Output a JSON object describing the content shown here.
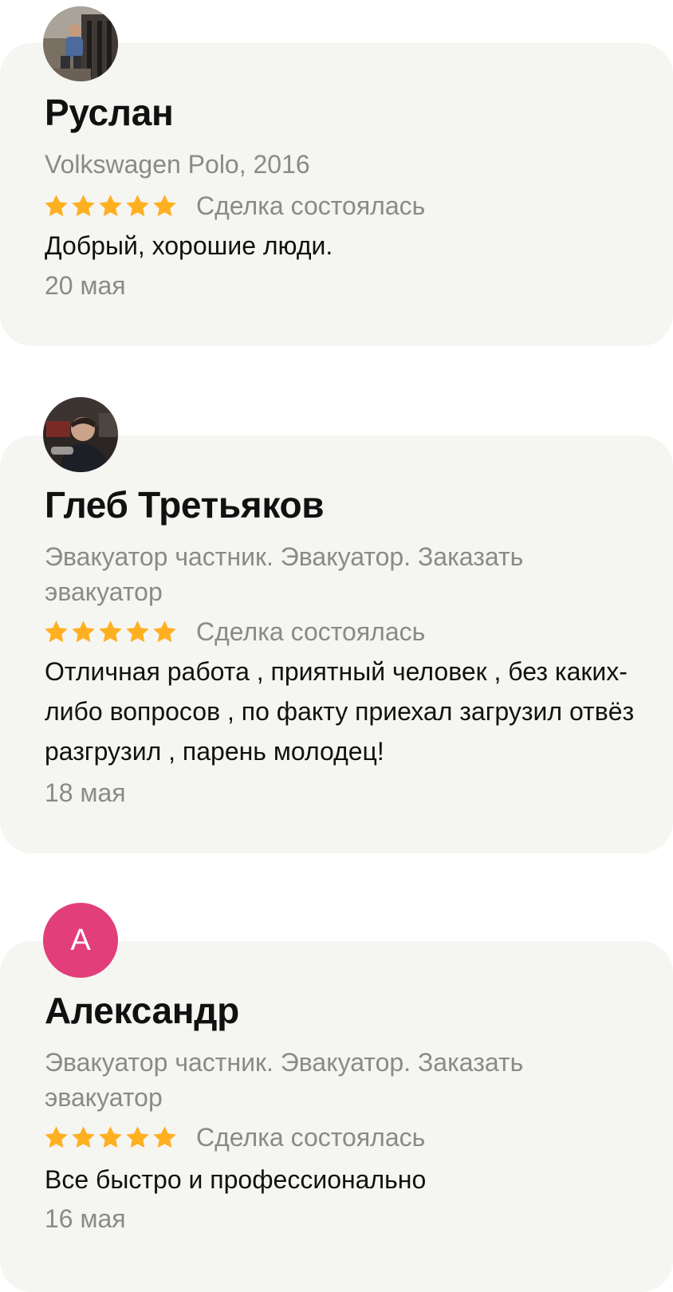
{
  "reviews": [
    {
      "name": "Руслан",
      "subject": "Volkswagen Polo, 2016",
      "rating": 5,
      "status": "Сделка состоялась",
      "text": "Добрый, хорошие люди.",
      "date": "20 мая"
    },
    {
      "name": "Глеб Третьяков",
      "subject": "Эвакуатор частник. Эвакуатор. Заказать эвакуатор",
      "rating": 5,
      "status": "Сделка состоялась",
      "text": "Отличная работа , приятный человек , без каких-либо вопросов , по факту приехал загрузил отвёз разгрузил , парень молодец!",
      "date": "18 мая"
    },
    {
      "name": "Александр",
      "avatar_letter": "А",
      "avatar_color": "#e23e79",
      "subject": "Эвакуатор частник. Эвакуатор. Заказать эвакуатор",
      "rating": 5,
      "status": "Сделка состоялась",
      "text": "Все быстро и профессионально",
      "date": "16 мая"
    }
  ],
  "colors": {
    "card_background": "#f5f5f2",
    "star": "#ffb021",
    "muted_text": "#8a8a8a",
    "primary_text": "#111111"
  },
  "icons": {
    "star": "star-icon"
  }
}
